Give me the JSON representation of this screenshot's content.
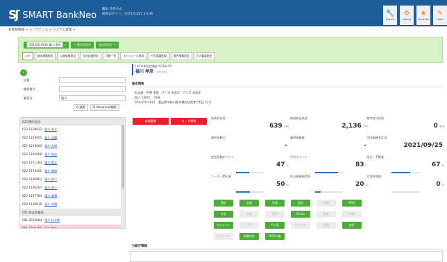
{
  "app": {
    "name": "SMART BankNeo",
    "logo_mark": "Sʃ"
  },
  "user": {
    "name": "藤本 正亮さん",
    "last_login": "前回ログイン：2021/03/22 10:26"
  },
  "toolbar": [
    {
      "label": "Search",
      "icon": "search-icon",
      "glyph": "🔧"
    },
    {
      "label": "setting",
      "icon": "setting-icon",
      "glyph": "⚙"
    },
    {
      "label": "Favorites",
      "icon": "favorites-icon",
      "glyph": "★"
    },
    {
      "label": "Hope",
      "icon": "hope-icon",
      "glyph": "✎"
    }
  ],
  "breadcrumb": "お客様情報 > メンテナンス > システム管理 >",
  "action_bar": {
    "customer_id_value": "001-0019456 福川 孝彦",
    "dropdown": "▾",
    "add_button": "＋ 最近利用先",
    "other_button": "過去利用先 ＋"
  },
  "tabs": [
    "TOP",
    "基本情報照会",
    "口座情報照会",
    "交渉記録照会",
    "活動一覧",
    "スケジュール登録",
    "行内稟議登録",
    "案件情報照会",
    "正式審査照会"
  ],
  "search": {
    "fields": [
      {
        "label": "店番:",
        "value": ""
      },
      {
        "label": "顧客番号:",
        "value": ""
      },
      {
        "label": "顧客名:",
        "value": "福川"
      }
    ],
    "search_button": "Q 検索",
    "advanced_button": "Q Advanced検索"
  },
  "results": {
    "groups": [
      {
        "header": "022)横浜支店",
        "items": [
          {
            "id": "022-1109932",
            "name": "福川 有斗"
          },
          {
            "id": "022-1123925",
            "name": "福川 浩輔"
          },
          {
            "id": "022-1143060",
            "name": "福川 大樹"
          },
          {
            "id": "022-1162668",
            "name": "福川 昌宏"
          },
          {
            "id": "022-1171184",
            "name": "福川 陽太"
          },
          {
            "id": "022-1174405",
            "name": "福川 健雄"
          },
          {
            "id": "022-1186963",
            "name": "福川 英二"
          },
          {
            "id": "022-1196267",
            "name": "福川 亮一"
          },
          {
            "id": "022-1197784",
            "name": "福川 美穂"
          },
          {
            "id": "022-1199918",
            "name": "福川 秀綱"
          }
        ]
      },
      {
        "header": "001)本店営業部",
        "items": [
          {
            "id": "001-0015684",
            "name": "福川 佳太郎"
          },
          {
            "id": "001-0019456",
            "name": "福川 孝彦",
            "selected": true
          }
        ]
      }
    ]
  },
  "customer": {
    "id": "(001)本店営業部 0019456",
    "name": "福川 孝彦",
    "kana": "ﾌｸｶﾜ ﾀｶﾋｺ"
  },
  "basic_title": "基本情報",
  "basic": {
    "line1": "担当者：円野 孝雄　(ｻﾌﾞ1) 未設定　(ｻﾌﾞ2) 未設定",
    "line2": "個人（男性）　26歳",
    "line3": "076-620-2687　富山県中新川郡舟橋村比良木2丁目-12-5"
  },
  "red_buttons": {
    "detail": "詳細登録",
    "card": "カード情報"
  },
  "stats": [
    {
      "label": "残高合計高",
      "value": "639",
      "unit": "千円",
      "bar": null
    },
    {
      "label": "総減資金残高",
      "value": "2,136",
      "unit": "千円",
      "bar": null
    },
    {
      "label": "貸付合計残高",
      "value": "0",
      "unit": "千円",
      "bar": null
    },
    {
      "label": "最終接触日",
      "value": "-",
      "unit": "",
      "bar": null
    },
    {
      "label": "最終接触者",
      "value": "-",
      "unit": "",
      "bar": null
    },
    {
      "label": "次回接触予定日",
      "value": "2021/09/25",
      "unit": "",
      "bar": null
    },
    {
      "label": "定型接触ポイント",
      "value": "47",
      "unit": "%",
      "bar": 0.47
    },
    {
      "label": "プライベート",
      "value": "83",
      "unit": "%",
      "bar": 0.83
    },
    {
      "label": "保全・不動産",
      "value": "67",
      "unit": "%",
      "bar": 0.67
    },
    {
      "label": "ニーズ・関心事",
      "value": "50",
      "unit": "%",
      "bar": 0.5
    },
    {
      "label": "住込情報取得率",
      "value": "20",
      "unit": "%",
      "bar": 0.2
    },
    {
      "label": "与信枠情報",
      "value": "0",
      "unit": "%",
      "bar": 0
    }
  ],
  "products": [
    {
      "label": "預金",
      "active": true
    },
    {
      "label": "定期",
      "active": true
    },
    {
      "label": "外貨",
      "active": true
    },
    {
      "label": "投信",
      "active": true
    },
    {
      "label": "保険",
      "active": false
    },
    {
      "label": "NISA",
      "active": true
    },
    {
      "label": "年金",
      "active": true
    },
    {
      "label": "年金",
      "active": false
    },
    {
      "label": "住宅",
      "active": false
    },
    {
      "label": "iDeCo",
      "active": true
    },
    {
      "label": "証券",
      "active": false
    },
    {
      "label": "外貨",
      "active": false
    },
    {
      "label": "クレジット",
      "active": true
    },
    {
      "label": "FX",
      "active": false
    },
    {
      "label": "ギル英",
      "active": true
    },
    {
      "label": "デビット",
      "active": false
    },
    {
      "label": "投信",
      "active": false
    },
    {
      "label": "信託",
      "active": true
    },
    {
      "label": "ビルメイト",
      "active": false
    },
    {
      "label": "投資信託",
      "active": true
    },
    {
      "label": "NISA口座",
      "active": true
    }
  ],
  "memo_title": "引継ぎ情報",
  "memo_value": ""
}
